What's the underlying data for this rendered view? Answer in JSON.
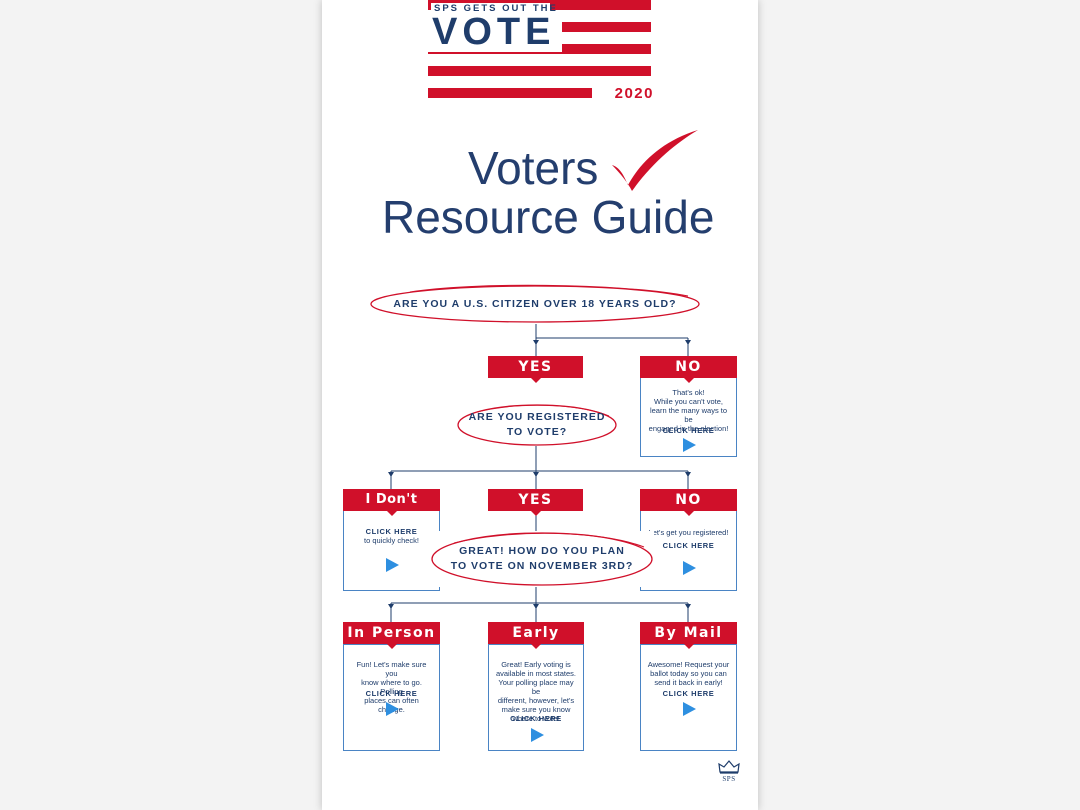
{
  "header": {
    "tagline": "SPS GETS OUT THE",
    "word": "VOTE",
    "year": "2020"
  },
  "title": {
    "line1": "Voters",
    "line2": "Resource Guide"
  },
  "flow": {
    "q1": "ARE YOU A U.S. CITIZEN OVER 18 YEARS OLD?",
    "q1_yes": "YES",
    "q1_no": "NO",
    "q1_no_text": "That's ok!\nWhile you can't vote,\nlearn the many ways to be\nengaged in the election!",
    "q2_line1": "ARE YOU REGISTERED",
    "q2_line2": "TO VOTE?",
    "q2_dontknow": "I Don't Know",
    "q2_yes": "YES",
    "q2_no": "NO",
    "dontknow_click": "CLICK HERE",
    "dontknow_text": "to quickly check!",
    "q2_no_text": "Let's get you registered!",
    "q3_line1": "GREAT! HOW DO YOU PLAN",
    "q3_line2": "TO VOTE ON NOVEMBER 3RD?",
    "inperson": "In Person",
    "inperson_text": "Fun! Let's make sure you\nknow where to go. Polling\nplaces can often change.",
    "early": "Early",
    "early_text": "Great! Early voting is\navailable in most states.\nYour polling place may be\ndifferent, however, let's\nmake sure you know\nwhere to vote!",
    "bymail": "By Mail",
    "bymail_text": "Awesome! Request your\nballot today so you can\nsend it back in early!",
    "click_here": "CLICK HERE"
  },
  "footer": {
    "logo_text": "SPS"
  },
  "colors": {
    "navy": "#1f3d6b",
    "red": "#d0102a",
    "blue_border": "#4a84c4",
    "play_blue": "#2e8fe0"
  },
  "icons": [
    "checkmark-icon",
    "play-icon",
    "crown-icon"
  ]
}
